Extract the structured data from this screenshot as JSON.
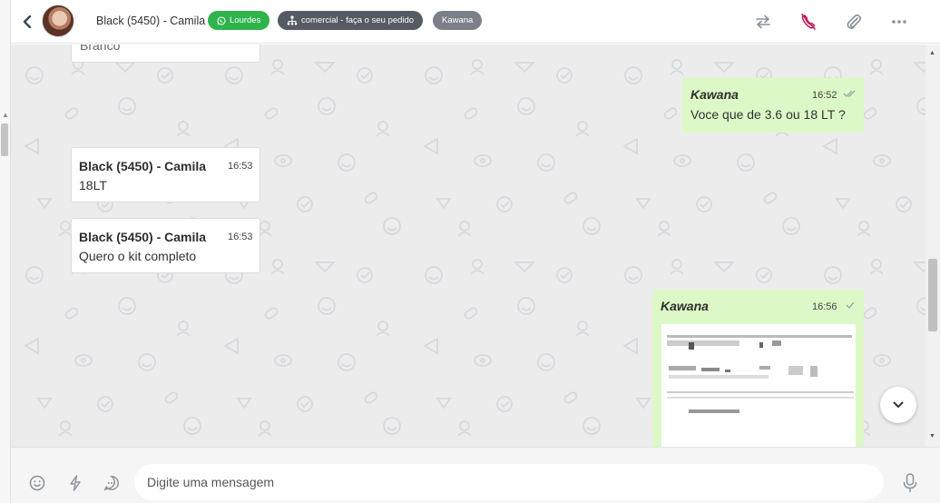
{
  "header": {
    "contact_name": "Black (5450) - Camila",
    "tags": [
      {
        "label": "Lourdes",
        "color": "#2fb44b",
        "icon": "whatsapp-icon"
      },
      {
        "label": "comercial - faça o seu pedido",
        "color": "#555b62",
        "icon": "sitemap-icon"
      },
      {
        "label": "Kawana",
        "color": "#7a8088"
      }
    ],
    "actions": [
      "transfer-icon",
      "end-call-icon",
      "attachment-icon",
      "more-icon"
    ]
  },
  "messages": [
    {
      "direction": "in",
      "text": "Branco",
      "partial": true
    },
    {
      "direction": "out",
      "sender": "Kawana",
      "time": "16:52",
      "text": "Voce que de 3.6 ou 18 LT ?",
      "status": "read"
    },
    {
      "direction": "in",
      "sender": "Black (5450) - Camila",
      "time": "16:53",
      "text": "18LT"
    },
    {
      "direction": "in",
      "sender": "Black (5450) - Camila",
      "time": "16:53",
      "text": "Quero o kit completo"
    },
    {
      "direction": "out",
      "sender": "Kawana",
      "time": "16:56",
      "type": "image",
      "status": "sent"
    }
  ],
  "composer": {
    "placeholder": "Digite uma mensagem",
    "icons": [
      "emoji-icon",
      "quick-reply-icon",
      "chat-bubble-icon",
      "microphone-icon"
    ]
  },
  "colors": {
    "outgoing_bubble": "#dcf8c6",
    "incoming_bubble": "#ffffff",
    "chat_background": "#ececec",
    "end_call": "#c2185b"
  }
}
